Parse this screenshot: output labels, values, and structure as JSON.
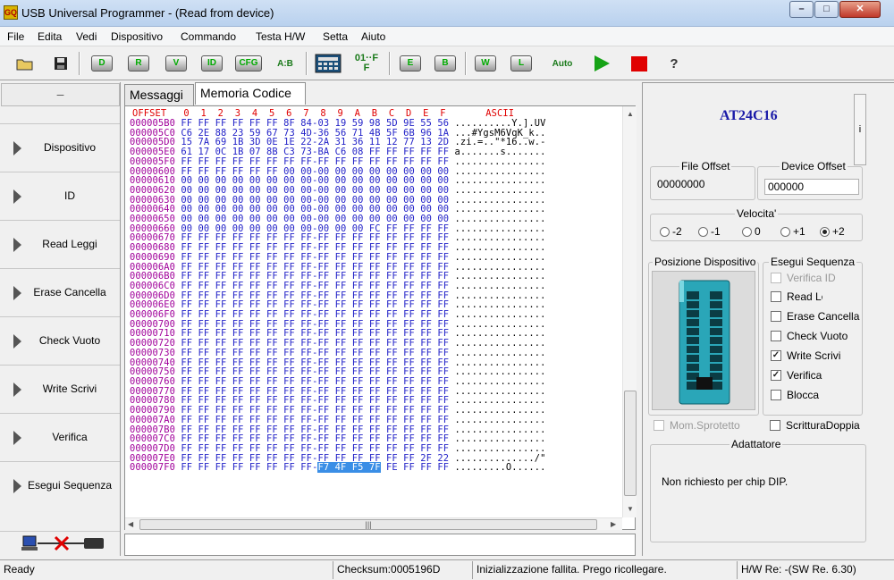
{
  "window": {
    "title": "USB Universal Programmer - (Read from device)",
    "app_icon_text": "GQ"
  },
  "menu": [
    "File",
    "Edita",
    "Vedi",
    "Dispositivo",
    "Commando",
    "Testa H/W",
    "Setta",
    "Aiuto"
  ],
  "toolbar": {
    "buttons": [
      {
        "name": "open-icon",
        "text": ""
      },
      {
        "name": "save-icon",
        "text": ""
      },
      {
        "name": "device-icon",
        "text": "D"
      },
      {
        "name": "read-icon",
        "text": "R"
      },
      {
        "name": "verify-icon",
        "text": "V"
      },
      {
        "name": "id-icon",
        "text": "ID"
      },
      {
        "name": "config-icon",
        "text": "CFG"
      },
      {
        "name": "swap-icon",
        "text": "A:B"
      },
      {
        "name": "calculator-icon",
        "text": ""
      },
      {
        "name": "fill-ff-icon",
        "text": "01··FF"
      },
      {
        "name": "erase-icon",
        "text": "E"
      },
      {
        "name": "blank-check-icon",
        "text": "B"
      },
      {
        "name": "write-icon",
        "text": "W"
      },
      {
        "name": "lock-icon",
        "text": "L"
      },
      {
        "name": "auto-icon",
        "text": "Auto"
      },
      {
        "name": "play-icon",
        "text": ""
      },
      {
        "name": "stop-icon",
        "text": ""
      },
      {
        "name": "help-icon",
        "text": "?"
      }
    ]
  },
  "left_panel": {
    "header": "–",
    "items": [
      "Dispositivo",
      "ID",
      "Read Leggi",
      "Erase Cancella",
      "Check Vuoto",
      "Write Scrivi",
      "Verifica",
      "Esegui Sequenza"
    ]
  },
  "tabs": [
    "Messaggi",
    "Memoria Codice"
  ],
  "hex": {
    "header": "OFFSET   0  1  2  3  4  5  6  7  8  9  A  B  C  D  E  F       ASCII",
    "rows": [
      {
        "off": "000005B0",
        "b1": "FF FF FF FF FF FF 8F 84",
        "b2": "03 19 59 98 5D 9E 55 56",
        "ascii": "..........Y.].UV"
      },
      {
        "off": "000005C0",
        "b1": "C6 2E 88 23 59 67 73 4D",
        "b2": "36 56 71 4B 5F 6B 96 1A",
        "ascii": "...#YgsM6VqK_k.."
      },
      {
        "off": "000005D0",
        "b1": "15 7A 69 1B 3D 0E 1E 22",
        "b2": "2A 31 36 11 12 77 13 2D",
        ".zi.=..\"*16..w.-": ".zi.=..\"*16..w.-",
        "ascii": ".zi.=..\"*16..w.-"
      },
      {
        "off": "000005E0",
        "b1": "61 17 0C 1B 07 8B C3 73",
        "b2": "BA C6 08 FF FF FF FF FF",
        "ascii": "a.......s......."
      },
      {
        "off": "000005F0",
        "b1": "FF FF FF FF FF FF FF FF",
        "b2": "FF FF FF FF FF FF FF FF",
        "ascii": "................"
      },
      {
        "off": "00000600",
        "b1": "FF FF FF FF FF FF 00 00",
        "b2": "00 00 00 00 00 00 00 00",
        "ascii": "................"
      },
      {
        "off": "00000610",
        "b1": "00 00 00 00 00 00 00 00",
        "b2": "00 00 00 00 00 00 00 00",
        "ascii": "................"
      },
      {
        "off": "00000620",
        "b1": "00 00 00 00 00 00 00 00",
        "b2": "00 00 00 00 00 00 00 00",
        "ascii": "................"
      },
      {
        "off": "00000630",
        "b1": "00 00 00 00 00 00 00 00",
        "b2": "00 00 00 00 00 00 00 00",
        "ascii": "................"
      },
      {
        "off": "00000640",
        "b1": "00 00 00 00 00 00 00 00",
        "b2": "00 00 00 00 00 00 00 00",
        "ascii": "................"
      },
      {
        "off": "00000650",
        "b1": "00 00 00 00 00 00 00 00",
        "b2": "00 00 00 00 00 00 00 00",
        "ascii": "................"
      },
      {
        "off": "00000660",
        "b1": "00 00 00 00 00 00 00 00",
        "b2": "00 00 00 FC FF FF FF FF",
        "ascii": "................"
      },
      {
        "off": "00000670",
        "b1": "FF FF FF FF FF FF FF FF",
        "b2": "FF FF FF FF FF FF FF FF",
        "ascii": "................"
      },
      {
        "off": "00000680",
        "b1": "FF FF FF FF FF FF FF FF",
        "b2": "FF FF FF FF FF FF FF FF",
        "ascii": "................"
      },
      {
        "off": "00000690",
        "b1": "FF FF FF FF FF FF FF FF",
        "b2": "FF FF FF FF FF FF FF FF",
        "ascii": "................"
      },
      {
        "off": "000006A0",
        "b1": "FF FF FF FF FF FF FF FF",
        "b2": "FF FF FF FF FF FF FF FF",
        "ascii": "................"
      },
      {
        "off": "000006B0",
        "b1": "FF FF FF FF FF FF FF FF",
        "b2": "FF FF FF FF FF FF FF FF",
        "ascii": "................"
      },
      {
        "off": "000006C0",
        "b1": "FF FF FF FF FF FF FF FF",
        "b2": "FF FF FF FF FF FF FF FF",
        "ascii": "................"
      },
      {
        "off": "000006D0",
        "b1": "FF FF FF FF FF FF FF FF",
        "b2": "FF FF FF FF FF FF FF FF",
        "ascii": "................"
      },
      {
        "off": "000006E0",
        "b1": "FF FF FF FF FF FF FF FF",
        "b2": "FF FF FF FF FF FF FF FF",
        "ascii": "................"
      },
      {
        "off": "000006F0",
        "b1": "FF FF FF FF FF FF FF FF",
        "b2": "FF FF FF FF FF FF FF FF",
        "ascii": "................"
      },
      {
        "off": "00000700",
        "b1": "FF FF FF FF FF FF FF FF",
        "b2": "FF FF FF FF FF FF FF FF",
        "ascii": "................"
      },
      {
        "off": "00000710",
        "b1": "FF FF FF FF FF FF FF FF",
        "b2": "FF FF FF FF FF FF FF FF",
        "ascii": "................"
      },
      {
        "off": "00000720",
        "b1": "FF FF FF FF FF FF FF FF",
        "b2": "FF FF FF FF FF FF FF FF",
        "ascii": "................"
      },
      {
        "off": "00000730",
        "b1": "FF FF FF FF FF FF FF FF",
        "b2": "FF FF FF FF FF FF FF FF",
        "ascii": "................"
      },
      {
        "off": "00000740",
        "b1": "FF FF FF FF FF FF FF FF",
        "b2": "FF FF FF FF FF FF FF FF",
        "ascii": "................"
      },
      {
        "off": "00000750",
        "b1": "FF FF FF FF FF FF FF FF",
        "b2": "FF FF FF FF FF FF FF FF",
        "ascii": "................"
      },
      {
        "off": "00000760",
        "b1": "FF FF FF FF FF FF FF FF",
        "b2": "FF FF FF FF FF FF FF FF",
        "ascii": "................"
      },
      {
        "off": "00000770",
        "b1": "FF FF FF FF FF FF FF FF",
        "b2": "FF FF FF FF FF FF FF FF",
        "ascii": "................"
      },
      {
        "off": "00000780",
        "b1": "FF FF FF FF FF FF FF FF",
        "b2": "FF FF FF FF FF FF FF FF",
        "ascii": "................"
      },
      {
        "off": "00000790",
        "b1": "FF FF FF FF FF FF FF FF",
        "b2": "FF FF FF FF FF FF FF FF",
        "ascii": "................"
      },
      {
        "off": "000007A0",
        "b1": "FF FF FF FF FF FF FF FF",
        "b2": "FF FF FF FF FF FF FF FF",
        "ascii": "................"
      },
      {
        "off": "000007B0",
        "b1": "FF FF FF FF FF FF FF FF",
        "b2": "FF FF FF FF FF FF FF FF",
        "ascii": "................"
      },
      {
        "off": "000007C0",
        "b1": "FF FF FF FF FF FF FF FF",
        "b2": "FF FF FF FF FF FF FF FF",
        "ascii": "................"
      },
      {
        "off": "000007D0",
        "b1": "FF FF FF FF FF FF FF FF",
        "b2": "FF FF FF FF FF FF FF FF",
        "ascii": "................"
      },
      {
        "off": "000007E0",
        "b1": "FF FF FF FF FF FF FF FF",
        "b2": "FF FF FF FF FF FF 2F 22",
        "ascii": "............../\""
      },
      {
        "off": "000007F0",
        "b1": "FF FF FF FF FF FF FF FF",
        "b2": "F7 4F F5 7F FE FF FF FF",
        "ascii": ".........O......"
      }
    ],
    "selection": "F7 4F F5 7F"
  },
  "device": {
    "name": "AT24C16",
    "info_label": "i"
  },
  "offsets": {
    "file_label": "File Offset",
    "file_value": "00000000",
    "device_label": "Device Offset",
    "device_value": "000000"
  },
  "speed": {
    "label": "Velocita'",
    "options": [
      "-2",
      "-1",
      "0",
      "+1",
      "+2"
    ],
    "selected": "+2"
  },
  "position": {
    "label": "Posizione Dispositivo"
  },
  "sequence": {
    "label": "Esegui Sequenza",
    "items": [
      {
        "label": "Verifica ID",
        "checked": false,
        "enabled": false
      },
      {
        "label": "Read Leggi",
        "checked": false,
        "enabled": true
      },
      {
        "label": "Erase Cancella",
        "checked": false,
        "enabled": true
      },
      {
        "label": "Check Vuoto",
        "checked": false,
        "enabled": true
      },
      {
        "label": "Write Scrivi",
        "checked": true,
        "enabled": true
      },
      {
        "label": "Verifica",
        "checked": true,
        "enabled": true
      },
      {
        "label": "Blocca",
        "checked": false,
        "enabled": true
      }
    ]
  },
  "mom_sprotetto": "Mom.Sprotetto",
  "scrittura_doppia": "ScritturaDoppia",
  "adapter": {
    "label": "Adattatore",
    "text": "Non richiesto per chip DIP."
  },
  "status": {
    "ready": "Ready",
    "checksum": "Checksum:0005196D",
    "message": "Inizializzazione fallita. Prego ricollegare.",
    "hw": "H/W Re: -(SW Re. 6.30)"
  },
  "colors": {
    "offset": "#a0009a",
    "bytes": "#2222c8",
    "header": "#e00000",
    "chip": "#1a1aa8",
    "selection": "#3a8ee6"
  }
}
